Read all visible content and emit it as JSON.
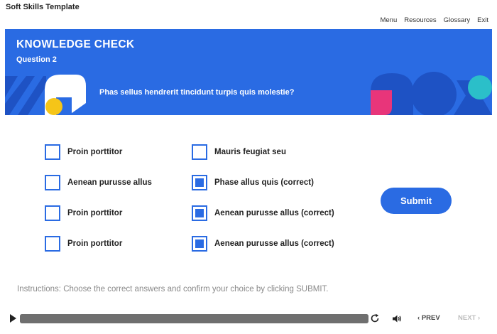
{
  "app": {
    "title": "Soft Skills Template"
  },
  "topnav": {
    "menu": "Menu",
    "resources": "Resources",
    "glossary": "Glossary",
    "exit": "Exit"
  },
  "banner": {
    "title": "KNOWLEDGE CHECK",
    "question_number": "Question 2",
    "question_text": "Phas sellus hendrerit tincidunt turpis quis molestie?"
  },
  "options": {
    "left": [
      {
        "label": "Proin porttitor",
        "checked": false
      },
      {
        "label": "Aenean purusse allus",
        "checked": false
      },
      {
        "label": "Proin porttitor",
        "checked": false
      },
      {
        "label": "Proin porttitor",
        "checked": false
      }
    ],
    "right": [
      {
        "label": "Mauris feugiat seu",
        "checked": false
      },
      {
        "label": "Phase allus quis (correct)",
        "checked": true
      },
      {
        "label": "Aenean purusse allus (correct)",
        "checked": true
      },
      {
        "label": "Aenean purusse allus (correct)",
        "checked": true
      }
    ]
  },
  "submit_label": "Submit",
  "instructions": "Instructions: Choose the correct answers and confirm your choice by clicking SUBMIT.",
  "player": {
    "progress": 1.0,
    "prev_label": "PREV",
    "next_label": "NEXT",
    "prev_icon": "chevron-left-icon",
    "next_icon": "chevron-right-icon"
  },
  "colors": {
    "accent": "#2a6be3",
    "banner_dark": "#1e52c4",
    "pink": "#e8357a",
    "yellow": "#f5c518",
    "teal": "#2bbfc9"
  }
}
